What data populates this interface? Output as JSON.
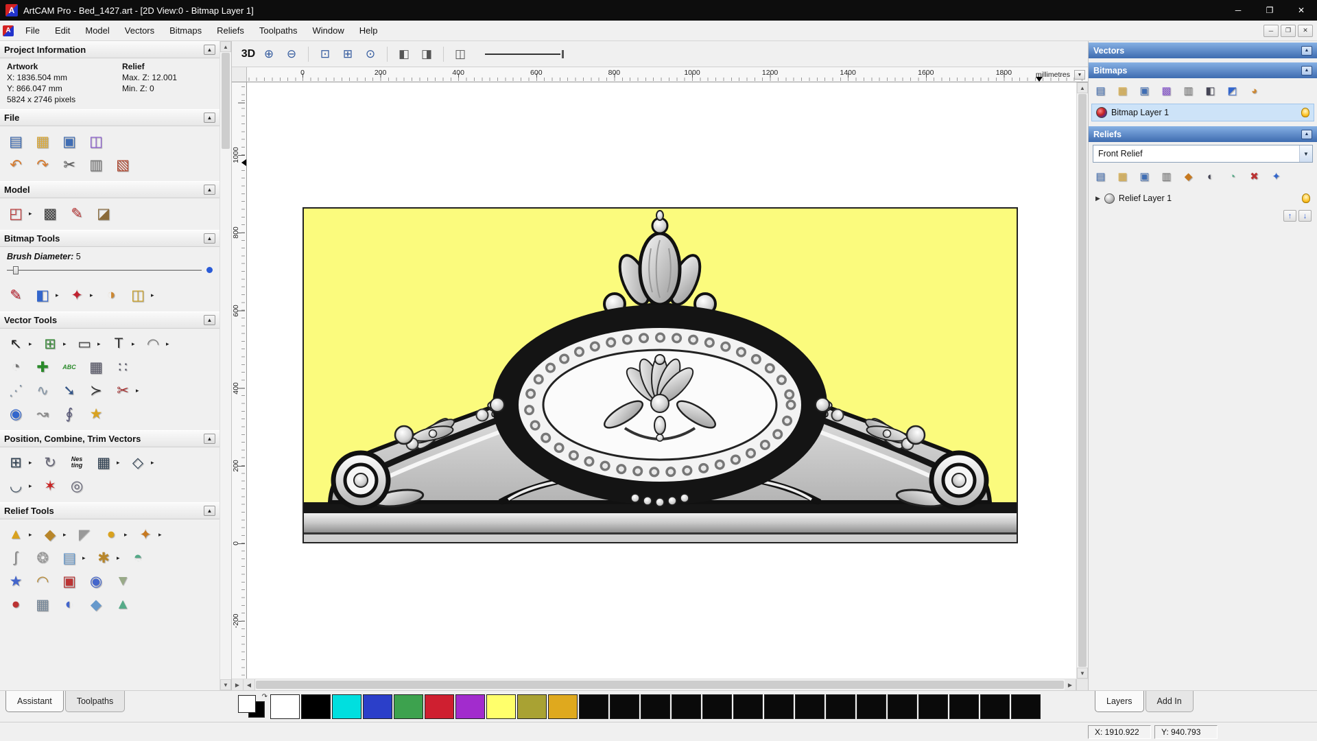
{
  "window": {
    "title": "ArtCAM Pro - Bed_1427.art - [2D View:0 - Bitmap Layer 1]"
  },
  "icons": {
    "flyout": "▸",
    "collapse": "▲",
    "dropdown": "▼",
    "expand": "▶",
    "up": "↑",
    "down": "↓",
    "scroll_up": "▲",
    "scroll_down": "▼",
    "scroll_left": "◀",
    "scroll_right": "▶",
    "swap": "↷",
    "minimize": "─",
    "maximize": "❐",
    "close": "✕",
    "logo": "A"
  },
  "menu": {
    "items": [
      "File",
      "Edit",
      "Model",
      "Vectors",
      "Bitmaps",
      "Reliefs",
      "Toolpaths",
      "Window",
      "Help"
    ]
  },
  "assistant": {
    "tabs": [
      {
        "label": "Assistant",
        "active": true
      },
      {
        "label": "Toolpaths",
        "active": false
      }
    ],
    "project_information": {
      "title": "Project Information",
      "artwork_label": "Artwork",
      "relief_label": "Relief",
      "x": "X: 1836.504 mm",
      "max_z": "Max. Z: 12.001",
      "y": "Y: 866.047 mm",
      "min_z": "Min. Z: 0",
      "pixels": "5824 x 2746 pixels"
    },
    "section_titles": {
      "file": "File",
      "model": "Model",
      "bitmap_tools": "Bitmap Tools",
      "vector_tools": "Vector Tools",
      "position": "Position, Combine, Trim Vectors",
      "relief_tools": "Relief Tools"
    },
    "brush": {
      "label": "Brush Diameter:",
      "value": "5"
    }
  },
  "toolsets": {
    "file": [
      [
        {
          "n": "new-model",
          "g": "▤",
          "c": "#3f6db4"
        },
        {
          "n": "open-model",
          "g": "▦",
          "c": "#d9a93c"
        },
        {
          "n": "save-model",
          "g": "▣",
          "c": "#3f6db4"
        },
        {
          "n": "import-file",
          "g": "◫",
          "c": "#8a5ad0"
        }
      ],
      [
        {
          "n": "undo",
          "g": "↶",
          "c": "#d97b2d"
        },
        {
          "n": "redo",
          "g": "↷",
          "c": "#d97b2d"
        },
        {
          "n": "cut",
          "g": "✂",
          "c": "#555555"
        },
        {
          "n": "copy",
          "g": "▥",
          "c": "#777777"
        },
        {
          "n": "paste",
          "g": "▧",
          "c": "#b0452d"
        }
      ]
    ],
    "model": [
      [
        {
          "n": "set-model-size",
          "g": "◰",
          "c": "#c03a3a",
          "f": true
        },
        {
          "n": "model-resolution",
          "g": "▩",
          "c": "#444444"
        },
        {
          "n": "notes",
          "g": "✎",
          "c": "#c03a3a"
        },
        {
          "n": "greyscale-preview",
          "g": "◪",
          "c": "#8a6a3a"
        }
      ]
    ],
    "bitmap": [
      [
        {
          "n": "paint",
          "g": "✎",
          "c": "#c02230"
        },
        {
          "n": "flood-fill",
          "g": "◧",
          "c": "#3366cc",
          "f": true
        },
        {
          "n": "colour-picker",
          "g": "✦",
          "c": "#c02230",
          "f": true
        },
        {
          "n": "colour-palette",
          "g": "◑",
          "c": "#cc8833"
        },
        {
          "n": "paint-texture",
          "g": "◫",
          "c": "#cca022",
          "f": true
        }
      ]
    ],
    "vector": [
      [
        {
          "n": "select-vectors",
          "g": "↖",
          "c": "#222222",
          "f": true
        },
        {
          "n": "transform-vectors",
          "g": "⊞",
          "c": "#3a8a3a",
          "f": true
        },
        {
          "n": "create-rectangle",
          "g": "▭",
          "c": "#444444",
          "f": true
        },
        {
          "n": "create-text",
          "g": "T",
          "c": "#333333",
          "f": true
        },
        {
          "n": "measure",
          "g": "◠",
          "c": "#777777",
          "f": true
        }
      ],
      [
        {
          "n": "vector-doctor",
          "g": "◔",
          "c": "#777777"
        },
        {
          "n": "paste-vector",
          "g": "✚",
          "c": "#2a8a2a"
        },
        {
          "n": "text-on-curve",
          "g": "ABC",
          "c": "#2a8a2a"
        },
        {
          "n": "snap-grid",
          "g": "▦",
          "c": "#555566"
        },
        {
          "n": "snap-points",
          "g": "∷",
          "c": "#555566"
        }
      ],
      [
        {
          "n": "create-polyline",
          "g": "⋰",
          "c": "#8899aa"
        },
        {
          "n": "free-smooth",
          "g": "∿",
          "c": "#8899aa"
        },
        {
          "n": "bezier-editor",
          "g": "➘",
          "c": "#335588"
        },
        {
          "n": "arc-editor",
          "g": "≻",
          "c": "#333333"
        },
        {
          "n": "trim-vectors",
          "g": "✂",
          "c": "#aa3333",
          "f": true
        }
      ],
      [
        {
          "n": "create-circle",
          "g": "◉",
          "c": "#3366cc"
        },
        {
          "n": "arc-fit",
          "g": "↝",
          "c": "#888888"
        },
        {
          "n": "node-editing",
          "g": "∮",
          "c": "#555577"
        },
        {
          "n": "create-star",
          "g": "★",
          "c": "#d9a21f"
        }
      ]
    ],
    "position": [
      [
        {
          "n": "align-vectors",
          "g": "⊞",
          "c": "#334455",
          "f": true
        },
        {
          "n": "circular-copy",
          "g": "↻",
          "c": "#666677"
        },
        {
          "n": "nesting",
          "g": "Nes\nting",
          "c": "#111111"
        },
        {
          "n": "block-copy",
          "g": "▦",
          "c": "#334455",
          "f": true
        },
        {
          "n": "offset-copy",
          "g": "◇",
          "c": "#334455",
          "f": true
        }
      ],
      [
        {
          "n": "fillet-tool",
          "g": "◡",
          "c": "#445566",
          "f": true
        },
        {
          "n": "weld-vectors",
          "g": "✶",
          "c": "#cc2222"
        },
        {
          "n": "wrap-vectors",
          "g": "◎",
          "c": "#666677"
        }
      ]
    ],
    "relief": [
      [
        {
          "n": "shape-editor",
          "g": "▲",
          "c": "#d9a21f",
          "f": true
        },
        {
          "n": "sculpting",
          "g": "◆",
          "c": "#b8862a",
          "f": true
        },
        {
          "n": "smooth-relief",
          "g": "◤",
          "c": "#999999"
        },
        {
          "n": "add-draft",
          "g": "●",
          "c": "#d9a21f",
          "f": true
        },
        {
          "n": "texture-relief",
          "g": "✦",
          "c": "#c7791f",
          "f": true
        }
      ],
      [
        {
          "n": "isoform",
          "g": "∫",
          "c": "#888888"
        },
        {
          "n": "weave-wizard",
          "g": "❂",
          "c": "#999999"
        },
        {
          "n": "offset-relief",
          "g": "▤",
          "c": "#6699cc",
          "f": true
        },
        {
          "n": "two-rail-sweep",
          "g": "✱",
          "c": "#b8862a",
          "f": true
        },
        {
          "n": "envelope-distortion",
          "g": "◓",
          "c": "#55aa88"
        }
      ],
      [
        {
          "n": "constant-height",
          "g": "★",
          "c": "#4466cc"
        },
        {
          "n": "wrap-relief",
          "g": "◠",
          "c": "#b8862a"
        },
        {
          "n": "paste-relief",
          "g": "▣",
          "c": "#bb3333"
        },
        {
          "n": "interactive-distortion",
          "g": "◉",
          "c": "#4466cc"
        },
        {
          "n": "extrude",
          "g": "▼",
          "c": "#99aa88"
        }
      ],
      [
        {
          "n": "turn-model",
          "g": "●",
          "c": "#bb3333"
        },
        {
          "n": "face-wizard",
          "g": "▦",
          "c": "#778899"
        },
        {
          "n": "texture-flow",
          "g": "◐",
          "c": "#4466cc"
        },
        {
          "n": "emboss-relief",
          "g": "◆",
          "c": "#6699cc"
        },
        {
          "n": "relief-clip",
          "g": "▲",
          "c": "#55aa88"
        }
      ]
    ],
    "view_bar": [
      [
        {
          "n": "zoom-in",
          "g": "⊕",
          "c": "#335a9e"
        },
        {
          "n": "zoom-out",
          "g": "⊖",
          "c": "#335a9e"
        },
        {
          "sep": true
        },
        {
          "n": "zoom-window",
          "g": "⊡",
          "c": "#335a9e"
        },
        {
          "n": "zoom-fit",
          "g": "⊞",
          "c": "#335a9e"
        },
        {
          "n": "zoom-previous",
          "g": "⊙",
          "c": "#335a9e"
        },
        {
          "sep": true
        },
        {
          "n": "toggle-bitmap-view",
          "g": "◧",
          "c": "#555555"
        },
        {
          "n": "toggle-vector-view",
          "g": "◨",
          "c": "#555555"
        },
        {
          "sep": true
        },
        {
          "n": "snapshot",
          "g": "◫",
          "c": "#555555"
        }
      ]
    ],
    "bitmaps_bar": [
      [
        {
          "n": "new-bitmap-layer",
          "g": "▤",
          "c": "#3f6db4"
        },
        {
          "n": "open-bitmap-layer",
          "g": "▦",
          "c": "#d9a93c"
        },
        {
          "n": "save-bitmap-layer",
          "g": "▣",
          "c": "#3f6db4"
        },
        {
          "n": "merge-layers",
          "g": "▩",
          "c": "#8a5ad0"
        },
        {
          "n": "duplicate-layer",
          "g": "▥",
          "c": "#777777"
        },
        {
          "n": "greyscale-toggle",
          "g": "◧",
          "c": "#444455"
        },
        {
          "n": "link-layer",
          "g": "◩",
          "c": "#3366cc"
        },
        {
          "n": "layer-palette",
          "g": "◕",
          "c": "#cc8833"
        }
      ]
    ],
    "reliefs_bar": [
      [
        {
          "n": "new-relief-layer",
          "g": "▤",
          "c": "#3f6db4"
        },
        {
          "n": "open-relief-layer",
          "g": "▦",
          "c": "#d9a93c"
        },
        {
          "n": "save-relief-layer",
          "g": "▣",
          "c": "#3f6db4"
        },
        {
          "n": "duplicate-relief-layer",
          "g": "▥",
          "c": "#777777"
        },
        {
          "n": "smooth-layer",
          "g": "◆",
          "c": "#c7791f"
        },
        {
          "n": "invert-layer",
          "g": "◐",
          "c": "#444455"
        },
        {
          "n": "calculate-relief",
          "g": "◔",
          "c": "#55aa88"
        },
        {
          "n": "delete-layer",
          "g": "✖",
          "c": "#bb3333"
        },
        {
          "n": "layer-properties",
          "g": "✦",
          "c": "#3366cc"
        }
      ]
    ]
  },
  "viewport": {
    "mode_button": "3D",
    "ruler_units": "millimetres",
    "h_ticks": [
      0,
      200,
      400,
      600,
      800,
      1000,
      1200,
      1400,
      1600,
      1800
    ],
    "v_ticks": [
      1000,
      800,
      600,
      400,
      200,
      0,
      -200
    ]
  },
  "layers_panel": {
    "tabs": [
      {
        "label": "Layers",
        "active": true
      },
      {
        "label": "Add In",
        "active": false
      }
    ],
    "vectors": {
      "title": "Vectors"
    },
    "bitmaps": {
      "title": "Bitmaps",
      "layers": [
        {
          "name": "Bitmap Layer 1",
          "selected": true
        }
      ]
    },
    "reliefs": {
      "title": "Reliefs",
      "combo_value": "Front Relief",
      "layers": [
        {
          "name": "Relief Layer 1"
        }
      ]
    }
  },
  "palette": {
    "foreground": "#ffffff",
    "background": "#000000",
    "colors": [
      "#ffffff",
      "#000000",
      "#00dfdf",
      "#2b3fc9",
      "#3da24e",
      "#cf1f30",
      "#a22ccd",
      "#ffff6b",
      "#a9a233",
      "#dfa91e",
      "#0a0a0a",
      "#0a0a0a",
      "#0a0a0a",
      "#0a0a0a",
      "#0a0a0a",
      "#0a0a0a",
      "#0a0a0a",
      "#0a0a0a",
      "#0a0a0a",
      "#0a0a0a",
      "#0a0a0a",
      "#0a0a0a",
      "#0a0a0a",
      "#0a0a0a",
      "#0a0a0a"
    ]
  },
  "status_bar": {
    "x": "X: 1910.922",
    "y": "Y: 940.793"
  }
}
